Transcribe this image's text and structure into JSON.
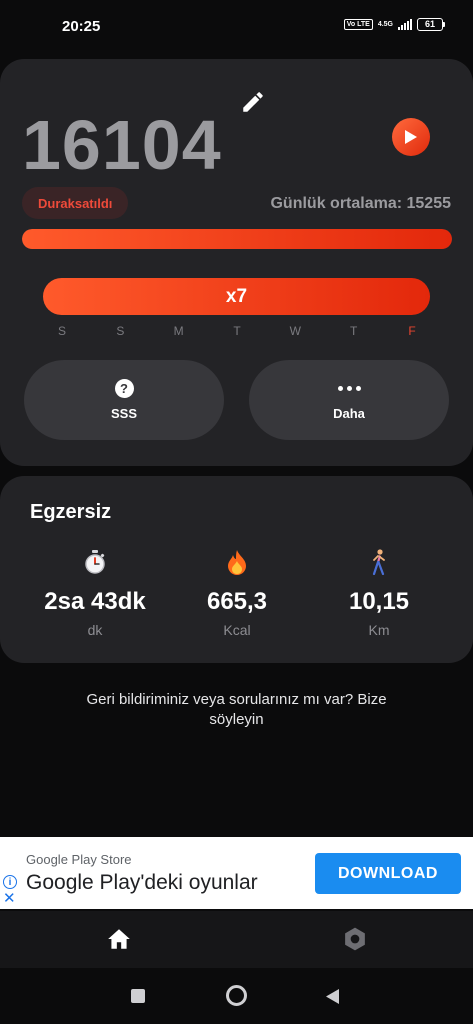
{
  "status_bar": {
    "time": "20:25",
    "volte_label": "Vo LTE",
    "network_label": "4.5G",
    "battery_level": "61"
  },
  "steps": {
    "count": "16104",
    "state_badge": "Duraksatıldı",
    "daily_average_text": "Günlük ortalama: 15255",
    "progress_fraction": 1.0
  },
  "streak": {
    "label": "x7",
    "weekdays": [
      {
        "letter": "S",
        "active": false
      },
      {
        "letter": "S",
        "active": false
      },
      {
        "letter": "M",
        "active": false
      },
      {
        "letter": "T",
        "active": false
      },
      {
        "letter": "W",
        "active": false
      },
      {
        "letter": "T",
        "active": false
      },
      {
        "letter": "F",
        "active": true
      }
    ]
  },
  "actions": {
    "faq_label": "SSS",
    "more_label": "Daha"
  },
  "exercise": {
    "title": "Egzersiz",
    "duration": {
      "icon": "stopwatch-icon",
      "value": "2sa 43dk",
      "unit": "dk"
    },
    "calories": {
      "icon": "fire-icon",
      "value": "665,3",
      "unit": "Kcal"
    },
    "distance": {
      "icon": "walking-person-icon",
      "value": "10,15",
      "unit": "Km"
    }
  },
  "feedback": {
    "text": "Geri bildiriminiz veya sorularınız mı var? Bize söyleyin"
  },
  "ad": {
    "source": "Google Play Store",
    "headline": "Google Play'deki oyunlar",
    "button_label": "DOWNLOAD",
    "info_glyph": "i",
    "close_glyph": "✕"
  },
  "bottom_nav": {
    "items": [
      {
        "icon": "home-icon",
        "active": true
      },
      {
        "icon": "settings-icon",
        "active": false
      }
    ]
  },
  "colors": {
    "accent": "#e3280b",
    "accent_light": "#ff5a2b",
    "background": "#0b0b0c",
    "card": "#232326",
    "ad_button": "#1a8cf0"
  }
}
